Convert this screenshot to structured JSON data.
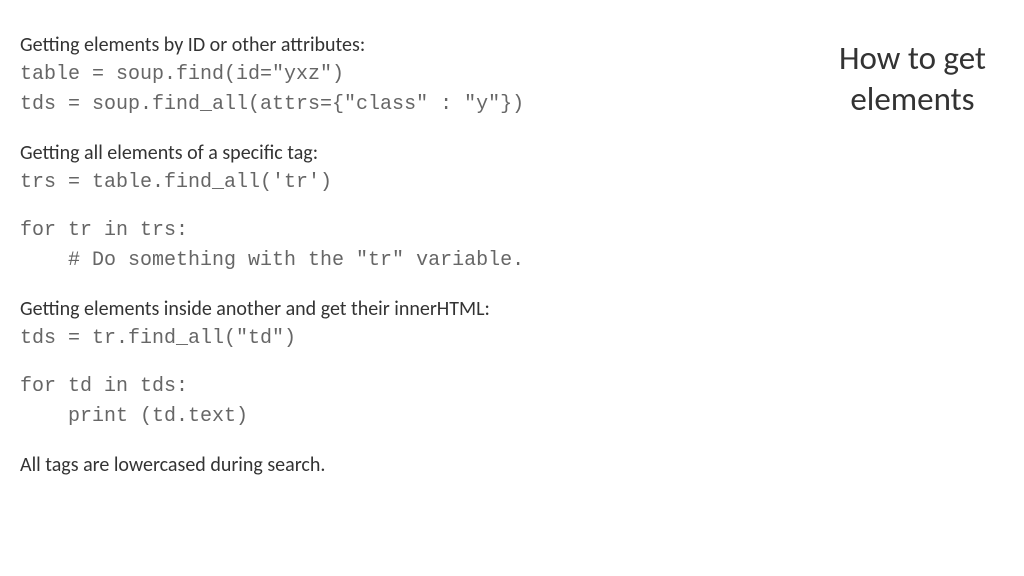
{
  "title_line1": "How to get",
  "title_line2": "elements",
  "section1": {
    "heading": "Getting elements by ID or other attributes:",
    "code1": "table = soup.find(id=\"yxz\")",
    "code2": "tds = soup.find_all(attrs={\"class\" : \"y\"})"
  },
  "section2": {
    "heading": "Getting all elements of a specific tag:",
    "code1": "trs = table.find_all('tr')",
    "code2": "for tr in trs:",
    "code3": "    # Do something with the \"tr\" variable."
  },
  "section3": {
    "heading": "Getting elements inside another and get their innerHTML:",
    "code1": "tds = tr.find_all(\"td\")",
    "code2": "for td in tds:",
    "code3": "    print (td.text)"
  },
  "footer": "All tags are lowercased during search."
}
